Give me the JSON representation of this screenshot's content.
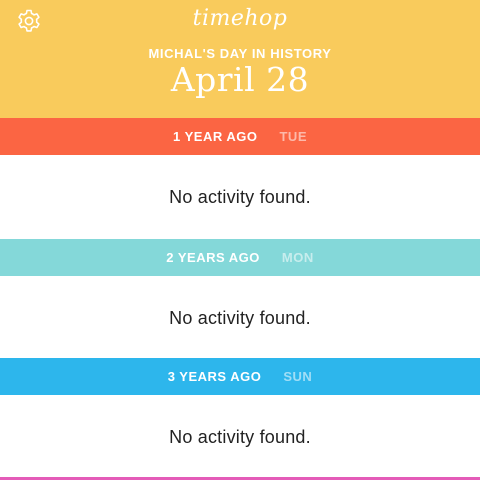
{
  "app": {
    "logo": "timehop",
    "subtitle": "MICHAL'S DAY IN HISTORY",
    "date": "April 28",
    "header_color": "#F9CB5C",
    "settings_icon": "gear-icon"
  },
  "sections": [
    {
      "label": "1 YEAR AGO",
      "day": "TUE",
      "color": "#FB6543",
      "empty_text": "No activity found."
    },
    {
      "label": "2 YEARS AGO",
      "day": "MON",
      "color": "#84D8D9",
      "empty_text": "No activity found."
    },
    {
      "label": "3 YEARS AGO",
      "day": "SUN",
      "color": "#2DB6EC",
      "empty_text": "No activity found."
    }
  ],
  "next_section_color": "#E45BB8"
}
